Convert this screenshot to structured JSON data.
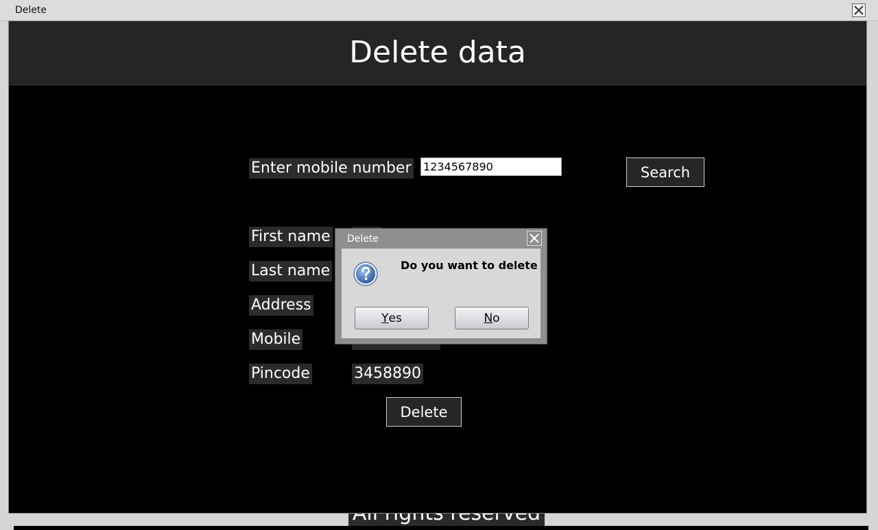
{
  "window": {
    "title": "Delete"
  },
  "header": {
    "title": "Delete data"
  },
  "search": {
    "label": "Enter mobile number",
    "value": "1234567890",
    "button": "Search"
  },
  "fields": {
    "first_name": {
      "label": "First name"
    },
    "last_name": {
      "label": "Last name"
    },
    "address": {
      "label": "Address"
    },
    "mobile": {
      "label": "Mobile"
    },
    "pincode": {
      "label": "Pincode",
      "value": "3458890"
    }
  },
  "delete_button": "Delete",
  "footer": {
    "text": "All rights reserved"
  },
  "dialog": {
    "title": "Delete",
    "message": "Do you want to delete",
    "icon": "question-icon",
    "yes": {
      "mnemonic": "Y",
      "rest": "es"
    },
    "no": {
      "mnemonic": "N",
      "rest": "o"
    }
  },
  "colors": {
    "background": "#000000",
    "header": "#252525",
    "label_bg": "#2b2b2b",
    "dialog_frame": "#8f8f8f",
    "dialog_body": "#d8d8d8"
  }
}
